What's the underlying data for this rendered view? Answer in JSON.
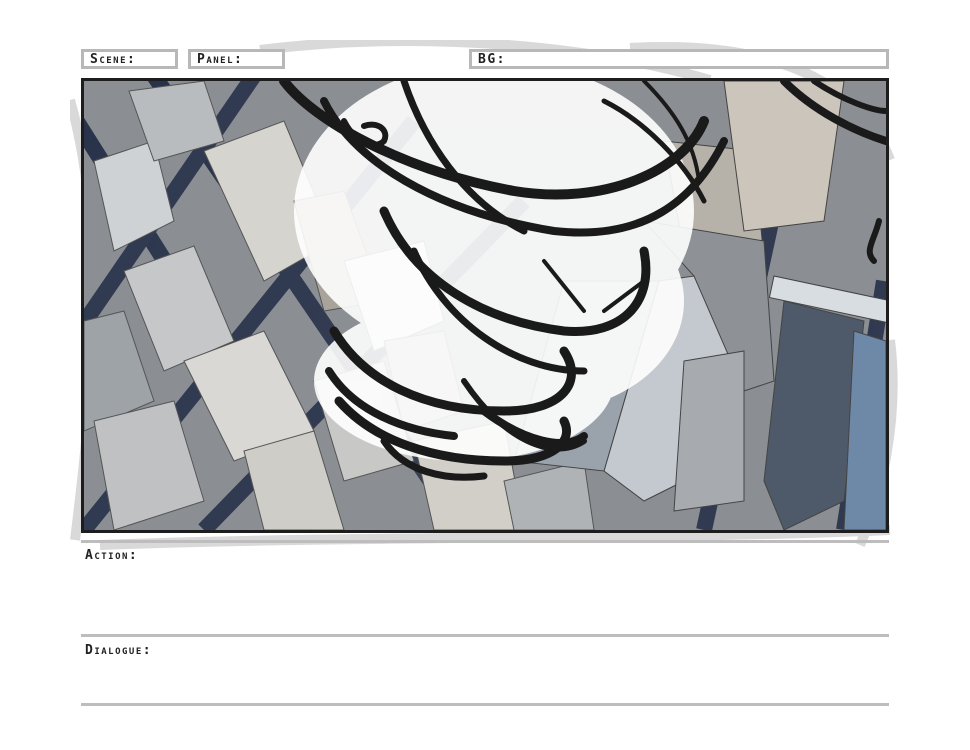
{
  "storyboard": {
    "scene_label": "Scene:",
    "panel_label": "Panel:",
    "bg_label": "BG:",
    "action_label": "Action:",
    "dialogue_label": "Dialogue:"
  },
  "colors": {
    "frame_border": "#1d1d1d",
    "rule": "#bdbdbd",
    "sketch_stroke": "#1a1a1a"
  }
}
